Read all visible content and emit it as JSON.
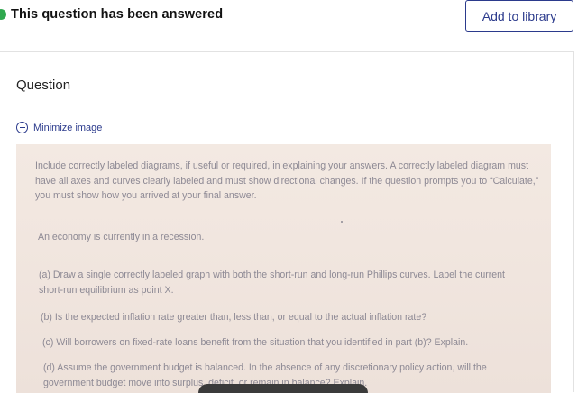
{
  "header": {
    "answered_text": "This question has been answered",
    "add_library_label": "Add to library",
    "accent_color": "#2b3a8c",
    "answered_icon": "check-circle-icon"
  },
  "question": {
    "title": "Question",
    "minimize_label": "Minimize image",
    "minimize_icon": "minus-circle-icon",
    "image_text": {
      "instructions": "Include correctly labeled diagrams, if useful or required, in explaining your answers. A correctly labeled diagram must have all axes and curves clearly labeled and must show directional changes. If the question prompts you to “Calculate,” you must show how you arrived at your final answer.",
      "economy": "An economy is currently in a recession.",
      "part_a": "(a) Draw a single correctly labeled graph with both the short-run and long-run Phillips curves. Label the current short-run equilibrium as point X.",
      "part_b": "(b) Is the expected inflation rate greater than, less than, or equal to the actual inflation rate?",
      "part_c": "(c) Will borrowers on fixed-rate loans benefit from the situation that you identified in part (b)? Explain.",
      "part_d": "(d) Assume the government budget is balanced. In the absence of any discretionary policy action, will the government budget move into surplus, deficit, or remain in balance? Explain."
    }
  }
}
